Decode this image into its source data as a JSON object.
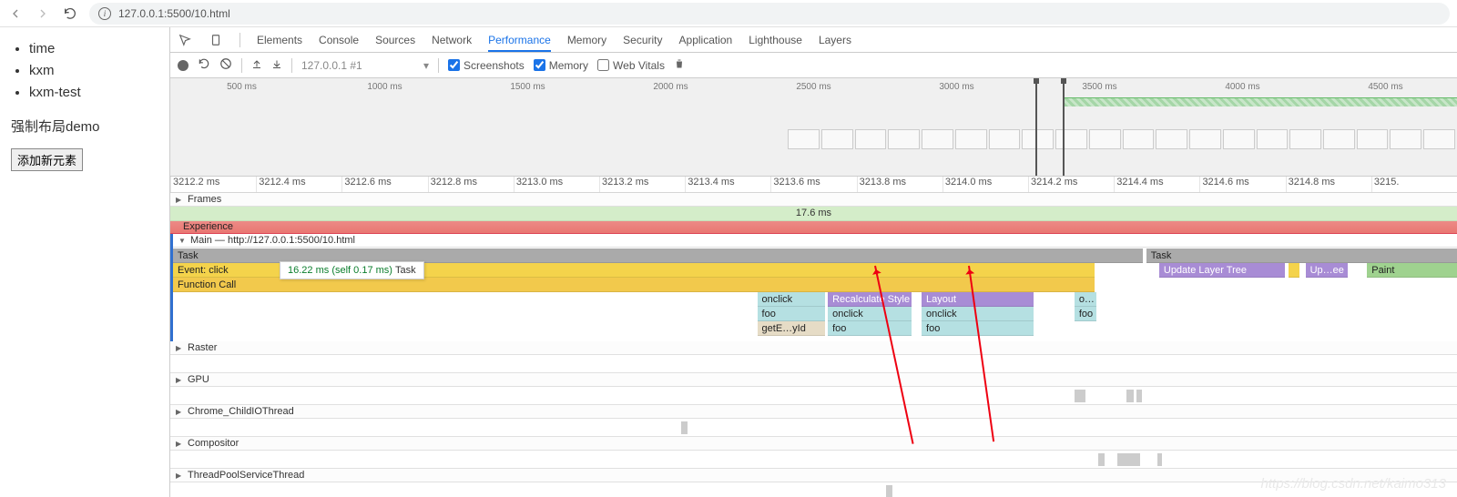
{
  "browser": {
    "url": "127.0.0.1:5500/10.html"
  },
  "page": {
    "list": [
      "time",
      "kxm",
      "kxm-test"
    ],
    "heading": "强制布局demo",
    "button": "添加新元素"
  },
  "devtools": {
    "tabs": [
      "Elements",
      "Console",
      "Sources",
      "Network",
      "Performance",
      "Memory",
      "Security",
      "Application",
      "Lighthouse",
      "Layers"
    ],
    "activeTab": "Performance",
    "toolbar": {
      "dropdown": "127.0.0.1 #1",
      "screenshots": "Screenshots",
      "memory": "Memory",
      "webvitals": "Web Vitals"
    },
    "overviewTicks": [
      "500 ms",
      "1000 ms",
      "1500 ms",
      "2000 ms",
      "2500 ms",
      "3000 ms",
      "3500 ms",
      "4000 ms",
      "4500 ms"
    ],
    "rulerTicks": [
      "3212.2 ms",
      "3212.4 ms",
      "3212.6 ms",
      "3212.8 ms",
      "3213.0 ms",
      "3213.2 ms",
      "3213.4 ms",
      "3213.6 ms",
      "3213.8 ms",
      "3214.0 ms",
      "3214.2 ms",
      "3214.4 ms",
      "3214.6 ms",
      "3214.8 ms",
      "3215."
    ],
    "frames": {
      "label": "Frames",
      "value": "17.6 ms"
    },
    "experience": "Experience",
    "main": {
      "label": "Main — http://127.0.0.1:5500/10.html",
      "task": "Task",
      "task2": "Task",
      "event": "Event: click",
      "func": "Function Call",
      "onclick1": "onclick",
      "foo1": "foo",
      "getid": "getE…yId",
      "recalc": "Recalculate Style",
      "onclick2": "onclick",
      "foo2": "foo",
      "layout": "Layout",
      "onclick3": "onclick",
      "foo3": "foo",
      "oshort": "o…",
      "fooshort": "foo",
      "updateLayer": "Update Layer Tree",
      "upshort": "Up…ee",
      "paint": "Paint"
    },
    "tooltip": {
      "timing": "16.22 ms (self 0.17 ms)",
      "label": "Task"
    },
    "subLanes": [
      "Raster",
      "GPU",
      "Chrome_ChildIOThread",
      "Compositor",
      "ThreadPoolServiceThread"
    ]
  },
  "watermark": "https://blog.csdn.net/kaimo313"
}
